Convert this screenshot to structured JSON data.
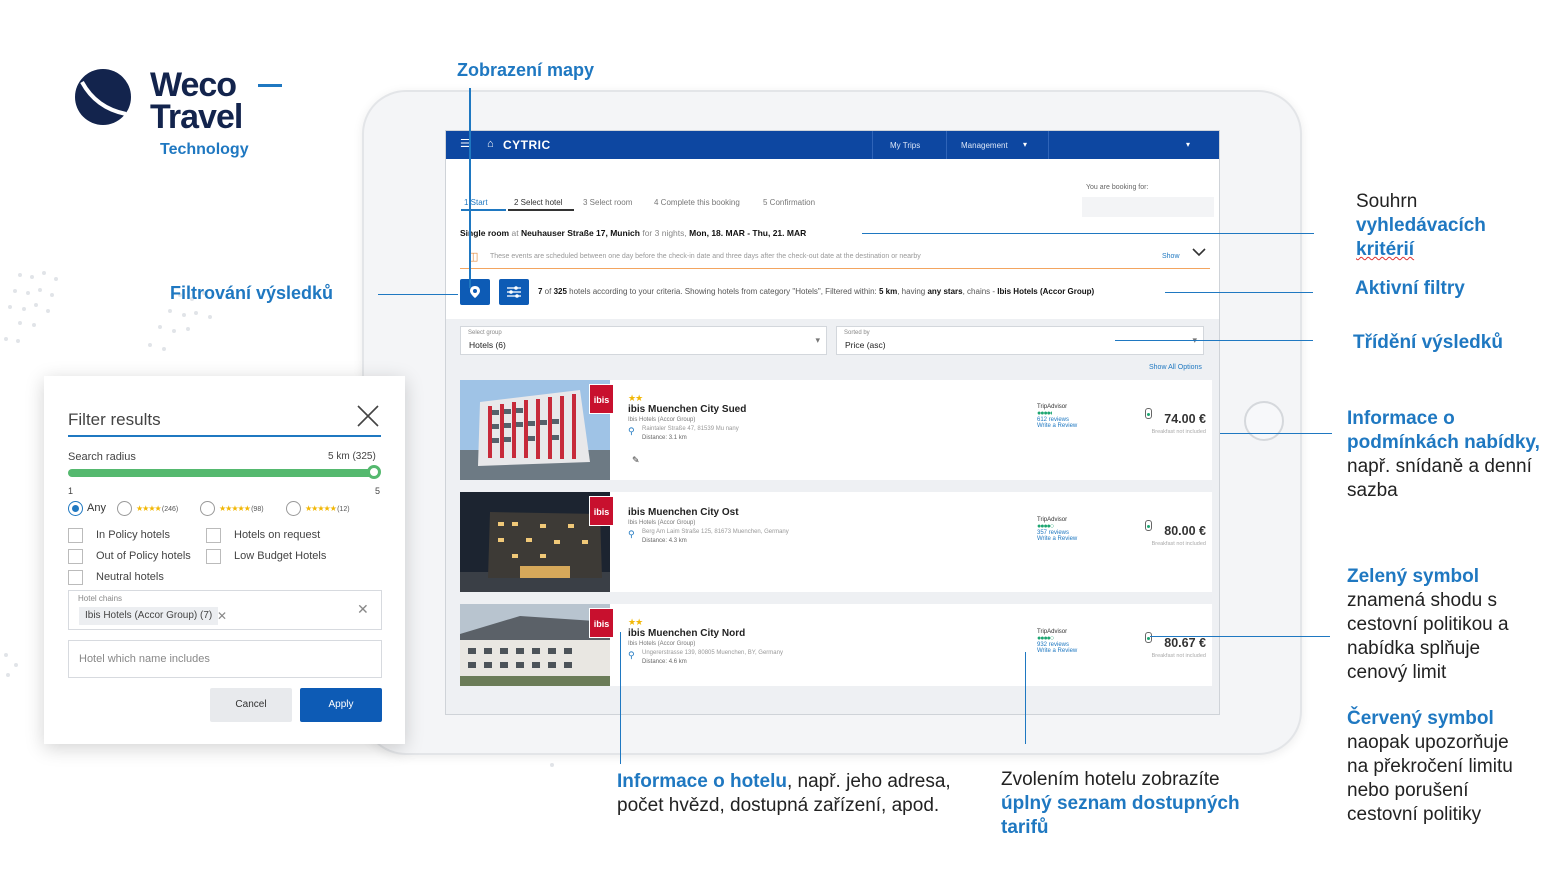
{
  "brand": {
    "name_line1": "Weco",
    "name_line2": "Travel",
    "tagline": "Technology"
  },
  "annotations": {
    "map_view": "Zobrazení mapy",
    "filtering": "Filtrování výsledků",
    "search_summary_1": "Souhrn",
    "search_summary_2": "vyhledávacích",
    "search_summary_3": "kritérií",
    "active_filters": "Aktivní filtry",
    "sorting": "Třídění výsledků",
    "offer_info_1": "Informace o",
    "offer_info_2": "podmínkách nabídky,",
    "offer_info_3": "např. snídaně a denní",
    "offer_info_4": "sazba",
    "green_1": "Zelený symbol",
    "green_2": "znamená shodu s",
    "green_3": "cestovní politikou a",
    "green_4": "nabídka splňuje",
    "green_5": "cenový limit",
    "red_1": "Červený symbol",
    "red_2": "naopak upozorňuje",
    "red_3": "na překročení limitu",
    "red_4": "nebo porušení",
    "red_5": "cestovní politiky",
    "hotel_info_bold": "Informace o hotelu",
    "hotel_info_rest": ", např. jeho adresa,",
    "hotel_info_2": "počet hvězd, dostupná zařízení, apod.",
    "select_hotel_1": "Zvolením hotelu zobrazíte",
    "select_hotel_2": "úplný seznam dostupných",
    "select_hotel_3": "tarifů"
  },
  "app": {
    "menu_icon": "hamburger-icon",
    "logo": "CYTRIC",
    "nav": {
      "my_trips": "My Trips",
      "management": "Management",
      "management_arrow": "▾",
      "user_arrow": "▾"
    },
    "steps": [
      "1  Start",
      "2  Select hotel",
      "3  Select room",
      "4  Complete this booking",
      "5  Confirmation"
    ],
    "booking_for_label": "You are booking for:",
    "search_summary": {
      "room": "Single room",
      "at": " at ",
      "address": "Neuhauser Straße 17, Munich",
      "nights": " for 3 nights, ",
      "dates": "Mon, 18. MAR - Thu, 21. MAR"
    },
    "events_text": "These events are scheduled between one day before the check-in date and three days after the check-out date at the destination or nearby",
    "events_show": "Show",
    "results": {
      "count": "7",
      "of": " of ",
      "total": "325",
      "text1": " hotels according to your criteria. Showing hotels from category \"Hotels\", Filtered within: ",
      "radius": "5 km",
      "text2": ", having ",
      "stars": "any stars",
      "text3": ", chains - ",
      "chain": "Ibis Hotels (Accor Group)"
    },
    "select_group": {
      "caption": "Select group",
      "value": "Hotels (6)"
    },
    "sorted_by": {
      "caption": "Sorted by",
      "value": "Price (asc)"
    },
    "show_all_options": "Show All Options",
    "hotels": [
      {
        "stars": "★★",
        "name": "ibis Muenchen City Sued",
        "chain": "Ibis Hotels (Accor Group)",
        "address": "Raintaler Straße 47, 81539 Mu                              nany",
        "distance_label": "Distance:",
        "distance": "3.1 km",
        "ta_label": "TripAdvisor",
        "ta_dots": "●●●●◐",
        "reviews": "612 reviews",
        "write_review": "Write a Review",
        "price": "74.00 €",
        "breakfast": "Breakfast not included",
        "logo": "ibis"
      },
      {
        "stars": "",
        "name": "ibis Muenchen City Ost",
        "chain": "Ibis Hotels (Accor Group)",
        "address": "Berg Am Laim Straße 125, 81673 Muenchen, Germany",
        "distance_label": "Distance:",
        "distance": "4.3 km",
        "ta_label": "TripAdvisor",
        "ta_dots": "●●●●○",
        "reviews": "357 reviews",
        "write_review": "Write a Review",
        "price": "80.00 €",
        "breakfast": "Breakfast not included",
        "logo": "ibis"
      },
      {
        "stars": "★★",
        "name": "ibis Muenchen City Nord",
        "chain": "Ibis Hotels (Accor Group)",
        "address": "Ungererstrasse 139, 80805 Muenchen, BY, Germany",
        "distance_label": "Distance:",
        "distance": "4.6 km",
        "ta_label": "TripAdvisor",
        "ta_dots": "●●●●○",
        "reviews": "932 reviews",
        "write_review": "Write a Review",
        "price": "80.67 €",
        "breakfast": "Breakfast not included",
        "logo": "ibis"
      }
    ]
  },
  "filter_panel": {
    "title": "Filter results",
    "search_radius_label": "Search radius",
    "search_radius_value": "5 km (325)",
    "radius_fraction": 1.0,
    "min": "1",
    "max": "5",
    "star_options": [
      {
        "label": "Any"
      },
      {
        "stars": "★★★★",
        "count": "(246)"
      },
      {
        "stars": "★★★★★",
        "count": "(98)"
      },
      {
        "stars": "★★★★★",
        "count": "(12)"
      }
    ],
    "checkboxes": [
      "In Policy hotels",
      "Hotels on request",
      "Out of Policy hotels",
      "Low Budget Hotels",
      "Neutral hotels"
    ],
    "hotel_chains_label": "Hotel chains",
    "hotel_chain_chip": "Ibis Hotels (Accor Group) (7)",
    "hotel_name_placeholder": "Hotel which name includes",
    "cancel": "Cancel",
    "apply": "Apply"
  },
  "colors": {
    "accent": "#1f78c1",
    "app_bar": "#0d47a1",
    "brand_navy": "#13244d",
    "policy_green": "#55b96f",
    "ibis_red": "#c8102e"
  }
}
